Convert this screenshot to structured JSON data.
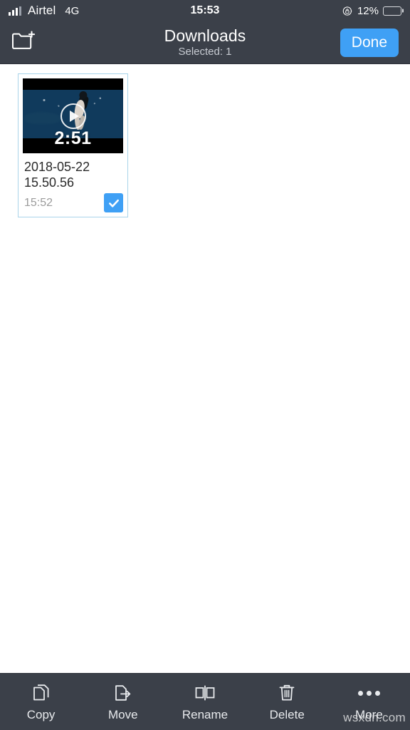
{
  "status_bar": {
    "carrier": "Airtel",
    "network": "4G",
    "time": "15:53",
    "battery_percent": "12%",
    "battery_level": 12,
    "signal_bars_filled": 3,
    "signal_bars_total": 4,
    "rotation_lock_icon": "rotation-lock-icon",
    "battery_color": "#ef3f35"
  },
  "nav_bar": {
    "new_folder_icon": "new-folder-icon",
    "title": "Downloads",
    "subtitle": "Selected: 1",
    "done_label": "Done",
    "accent_color": "#3fa0f5",
    "bar_color": "#3b4049"
  },
  "files": [
    {
      "name": "2018-05-22 15.50.56",
      "time": "15:52",
      "duration": "2:51",
      "type": "video",
      "selected": true,
      "play_icon": "play-icon",
      "check_icon": "check-icon"
    }
  ],
  "toolbar": {
    "items": [
      {
        "label": "Copy",
        "icon": "copy-icon"
      },
      {
        "label": "Move",
        "icon": "move-icon"
      },
      {
        "label": "Rename",
        "icon": "rename-icon"
      },
      {
        "label": "Delete",
        "icon": "trash-icon"
      },
      {
        "label": "More",
        "icon": "more-dots-icon"
      }
    ]
  },
  "watermark": "wsxdn.com"
}
